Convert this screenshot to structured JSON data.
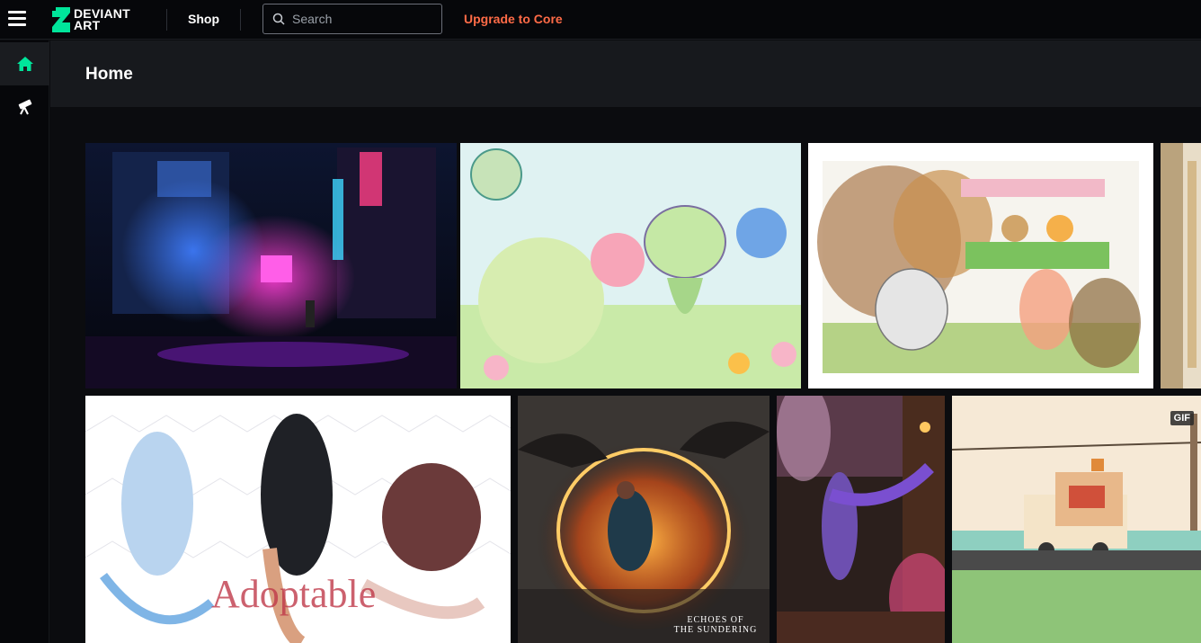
{
  "header": {
    "logo_text": "DEVIANT\nART",
    "shop_label": "Shop",
    "search_placeholder": "Search",
    "upgrade_label": "Upgrade to Core"
  },
  "sidenav": {
    "items": [
      {
        "icon": "home-icon",
        "active": true
      },
      {
        "icon": "telescope-icon",
        "active": false
      }
    ]
  },
  "page": {
    "title": "Home"
  },
  "gallery": {
    "tiles": [
      {
        "id": "neon-alley"
      },
      {
        "id": "bisquii-flower"
      },
      {
        "id": "cat-market"
      },
      {
        "id": "partial-right"
      },
      {
        "id": "adoptables"
      },
      {
        "id": "echoes-sundering",
        "caption": "ECHOES OF\nTHE SUNDERING"
      },
      {
        "id": "cosplay"
      },
      {
        "id": "pixel-van",
        "badge": "GIF"
      }
    ]
  },
  "colors": {
    "accent_green": "#00e59b",
    "upgrade": "#ff6b47",
    "background": "#0b0c0f",
    "topbar": "#06070a"
  }
}
